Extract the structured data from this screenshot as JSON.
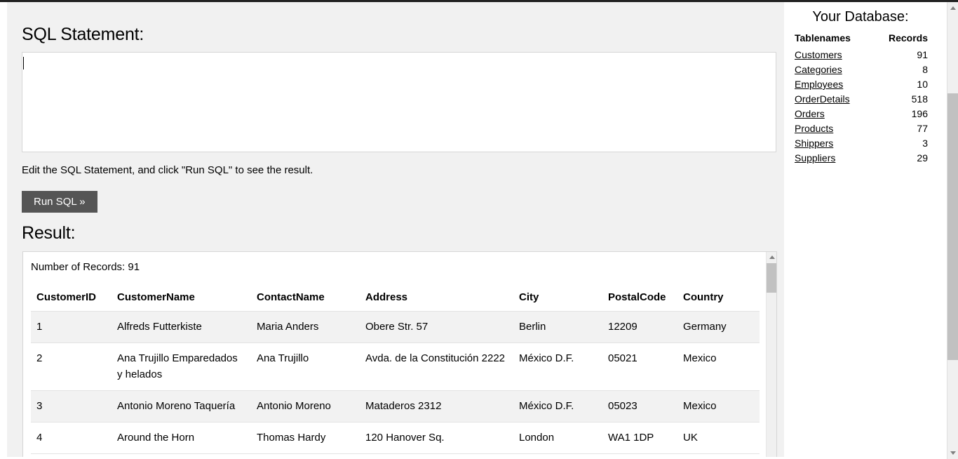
{
  "main": {
    "sql_title": "SQL Statement:",
    "sql_value": "",
    "sql_placeholder": "",
    "hint": "Edit the SQL Statement, and click \"Run SQL\" to see the result.",
    "run_button": "Run SQL »",
    "result_title": "Result:",
    "records_count": "Number of Records: 91"
  },
  "result_table": {
    "columns": [
      "CustomerID",
      "CustomerName",
      "ContactName",
      "Address",
      "City",
      "PostalCode",
      "Country"
    ],
    "rows": [
      {
        "CustomerID": "1",
        "CustomerName": "Alfreds Futterkiste",
        "ContactName": "Maria Anders",
        "Address": "Obere Str. 57",
        "City": "Berlin",
        "PostalCode": "12209",
        "Country": "Germany"
      },
      {
        "CustomerID": "2",
        "CustomerName": "Ana Trujillo Emparedados y helados",
        "ContactName": "Ana Trujillo",
        "Address": "Avda. de la Constitución 2222",
        "City": "México D.F.",
        "PostalCode": "05021",
        "Country": "Mexico"
      },
      {
        "CustomerID": "3",
        "CustomerName": "Antonio Moreno Taquería",
        "ContactName": "Antonio Moreno",
        "Address": "Mataderos 2312",
        "City": "México D.F.",
        "PostalCode": "05023",
        "Country": "Mexico"
      },
      {
        "CustomerID": "4",
        "CustomerName": "Around the Horn",
        "ContactName": "Thomas Hardy",
        "Address": "120 Hanover Sq.",
        "City": "London",
        "PostalCode": "WA1 1DP",
        "Country": "UK"
      }
    ]
  },
  "sidebar": {
    "title": "Your Database:",
    "header_tablenames": "Tablenames",
    "header_records": "Records",
    "tables": [
      {
        "name": "Customers",
        "records": "91"
      },
      {
        "name": "Categories",
        "records": "8"
      },
      {
        "name": "Employees",
        "records": "10"
      },
      {
        "name": "OrderDetails",
        "records": "518"
      },
      {
        "name": "Orders",
        "records": "196"
      },
      {
        "name": "Products",
        "records": "77"
      },
      {
        "name": "Shippers",
        "records": "3"
      },
      {
        "name": "Suppliers",
        "records": "29"
      }
    ]
  },
  "colors": {
    "panel_background": "#f1f1f1",
    "button_background": "#555555",
    "row_stripe": "#f2f2f2",
    "scrollbar_thumb": "#c1c1c1",
    "text": "#000000"
  }
}
